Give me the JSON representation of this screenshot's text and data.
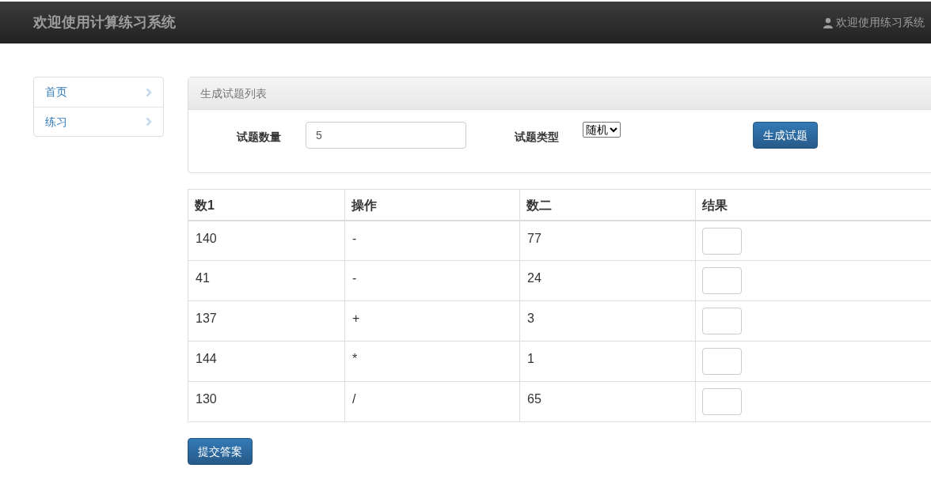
{
  "navbar": {
    "brand": "欢迎使用计算练习系统",
    "user": "欢迎使用练习系统"
  },
  "sidebar": {
    "items": [
      {
        "label": "首页"
      },
      {
        "label": "练习"
      }
    ]
  },
  "panel": {
    "title": "生成试题列表",
    "count_label": "试题数量",
    "count_value": "5",
    "type_label": "试题类型",
    "type_value": "随机",
    "generate_button": "生成试题"
  },
  "table": {
    "columns": [
      "数1",
      "操作",
      "数二",
      "结果"
    ],
    "rows": [
      [
        "140",
        "-",
        "77"
      ],
      [
        "41",
        "-",
        "24"
      ],
      [
        "137",
        "+",
        "3"
      ],
      [
        "144",
        "*",
        "1"
      ],
      [
        "130",
        "/",
        "65"
      ]
    ]
  },
  "submit_button": "提交答案"
}
